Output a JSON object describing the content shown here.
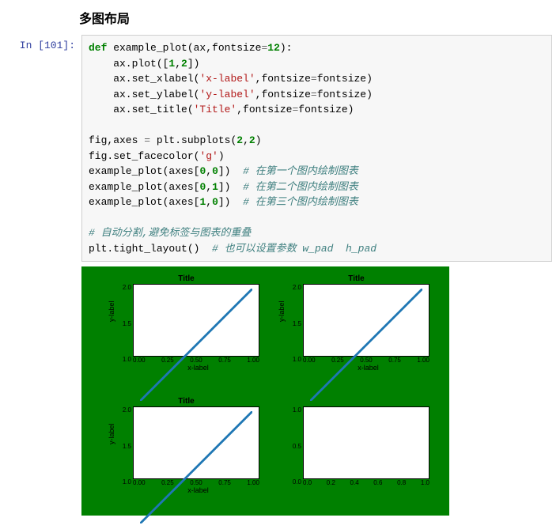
{
  "heading": "多图布局",
  "prompt": "In  [101]:",
  "code": {
    "l1a": "def",
    "l1b": " example_plot(ax,fontsize",
    "l1c": "=",
    "l1d": "12",
    "l1e": "):",
    "l2": "    ax.plot([",
    "l2a": "1",
    "l2b": ",",
    "l2c": "2",
    "l2d": "])",
    "l3": "    ax.set_xlabel(",
    "l3a": "'x-label'",
    "l3b": ",fontsize",
    "l3c": "=",
    "l3d": "fontsize)",
    "l4": "    ax.set_ylabel(",
    "l4a": "'y-label'",
    "l4b": ",fontsize",
    "l4c": "=",
    "l4d": "fontsize)",
    "l5": "    ax.set_title(",
    "l5a": "'Title'",
    "l5b": ",fontsize",
    "l5c": "=",
    "l5d": "fontsize)",
    "l6": "fig,axes ",
    "l6a": "=",
    "l6b": " plt.subplots(",
    "l6c": "2",
    "l6d": ",",
    "l6e": "2",
    "l6f": ")",
    "l7": "fig.set_facecolor(",
    "l7a": "'g'",
    "l7b": ")",
    "l8": "example_plot(axes[",
    "l8a": "0",
    "l8b": ",",
    "l8c": "0",
    "l8d": "])  ",
    "l8e": "# 在第一个图内绘制图表",
    "l9": "example_plot(axes[",
    "l9a": "0",
    "l9b": ",",
    "l9c": "1",
    "l9d": "])  ",
    "l9e": "# 在第二个图内绘制图表",
    "l10": "example_plot(axes[",
    "l10a": "1",
    "l10b": ",",
    "l10c": "0",
    "l10d": "])  ",
    "l10e": "# 在第三个图内绘制图表",
    "l11": "# 自动分割,避免标签与图表的重叠",
    "l12": "plt.tight_layout()  ",
    "l12a": "# 也可以设置参数 w_pad  h_pad"
  },
  "chart_data": [
    {
      "type": "line",
      "title": "Title",
      "xlabel": "x-label",
      "ylabel": "y-label",
      "xticks": [
        "0.00",
        "0.25",
        "0.50",
        "0.75",
        "1.00"
      ],
      "yticks": [
        "1.0",
        "1.5",
        "2.0"
      ],
      "x": [
        0,
        1
      ],
      "y": [
        1,
        2
      ]
    },
    {
      "type": "line",
      "title": "Title",
      "xlabel": "x-label",
      "ylabel": "y-label",
      "xticks": [
        "0.00",
        "0.25",
        "0.50",
        "0.75",
        "1.00"
      ],
      "yticks": [
        "1.0",
        "1.5",
        "2.0"
      ],
      "x": [
        0,
        1
      ],
      "y": [
        1,
        2
      ]
    },
    {
      "type": "line",
      "title": "Title",
      "xlabel": "x-label",
      "ylabel": "y-label",
      "xticks": [
        "0.00",
        "0.25",
        "0.50",
        "0.75",
        "1.00"
      ],
      "yticks": [
        "1.0",
        "1.5",
        "2.0"
      ],
      "x": [
        0,
        1
      ],
      "y": [
        1,
        2
      ]
    },
    {
      "type": "line",
      "title": "",
      "xlabel": "",
      "ylabel": "",
      "xticks": [
        "0.0",
        "0.2",
        "0.4",
        "0.6",
        "0.8",
        "1.0"
      ],
      "yticks": [
        "0.0",
        "0.5",
        "1.0"
      ],
      "x": [],
      "y": []
    }
  ]
}
